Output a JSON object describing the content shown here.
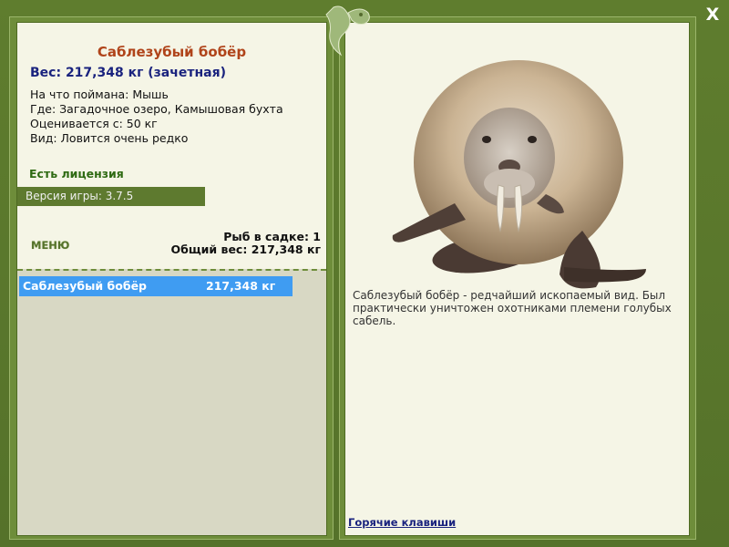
{
  "fish": {
    "name": "Саблезубый бобёр",
    "weight_line": "Вес: 217,348 кг (зачетная)",
    "caught_on": "На что поймана: Мышь",
    "location": "Где: Загадочное озеро, Камышовая бухта",
    "valued_from": "Оценивается с: 50 кг",
    "rarity": "Вид: Ловится очень редко",
    "description": "Саблезубый бобёр - редчайший ископаемый вид. Был практически уничтожен охотниками племени голубых сабель."
  },
  "status": {
    "license": "Есть лицензия",
    "game_version": "Версия игры: 3.7.5"
  },
  "menu": {
    "label": "МЕНЮ"
  },
  "keepnet": {
    "count": "Рыб в садке: 1",
    "total_weight": "Общий вес: 217,348 кг",
    "items": [
      {
        "name": "Саблезубый бобёр",
        "weight": "217,348 кг"
      }
    ]
  },
  "links": {
    "hotkeys": "Горячие клавиши"
  },
  "window": {
    "close_label": "X"
  },
  "colors": {
    "frame": "#5e7a2f",
    "panel_bg": "#f5f5e6",
    "fish_title": "#b0441a",
    "weight": "#1a237e",
    "selection": "#3f9cf2"
  },
  "icons": {
    "logo": "leaf-logo-icon",
    "close": "close-icon",
    "fish_image": "beaver-image"
  }
}
